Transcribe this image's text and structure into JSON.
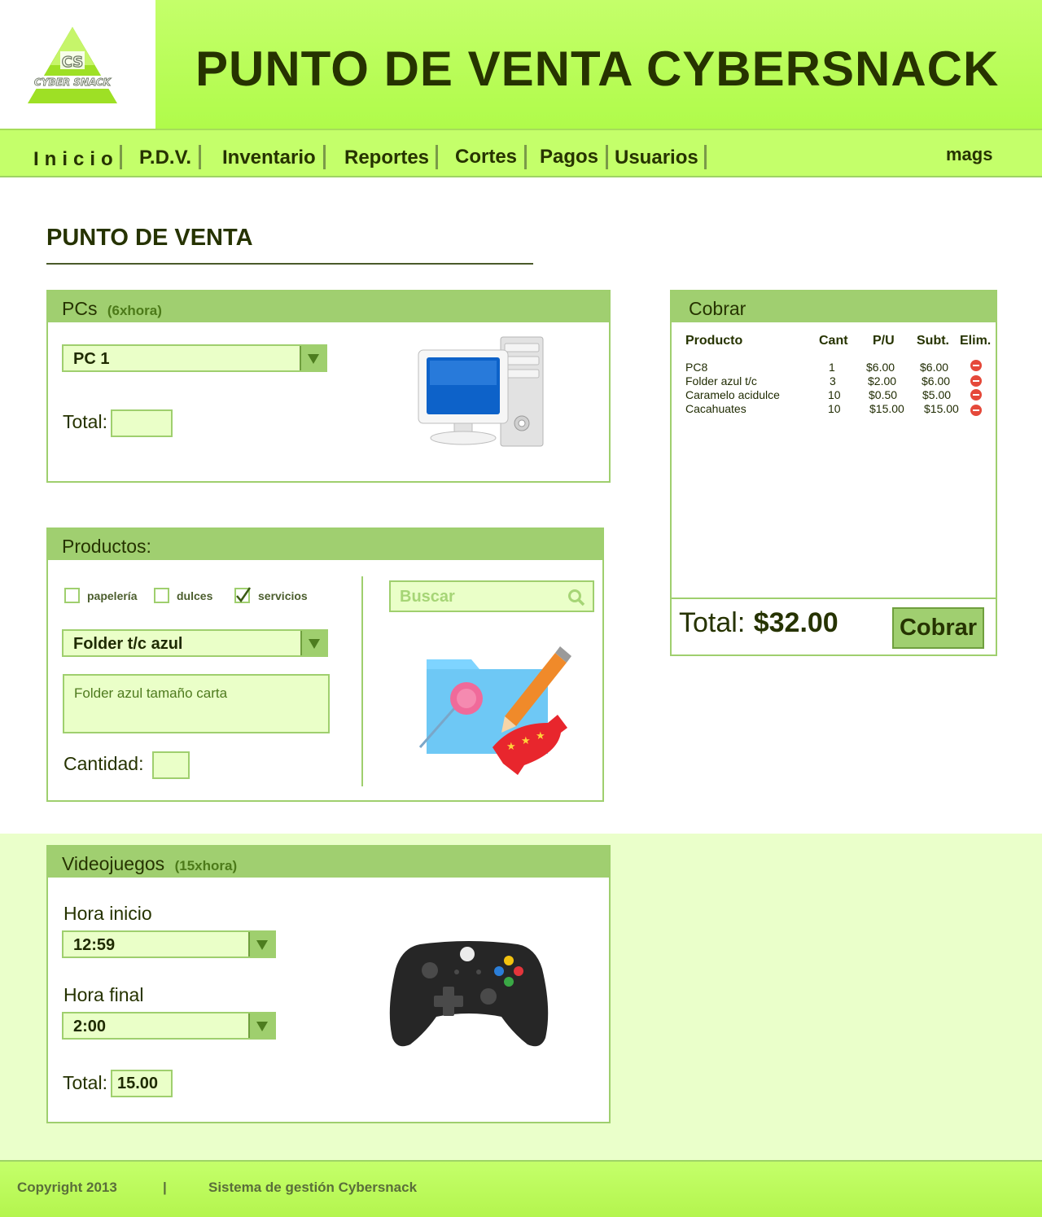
{
  "header": {
    "title": "PUNTO DE VENTA CYBERSNACK",
    "logo_text": "CYBER SNACK",
    "logo_initials": "CS"
  },
  "nav": {
    "items": [
      "Inicio",
      "P.D.V.",
      "Inventario",
      "Reportes",
      "Cortes",
      "Pagos",
      "Usuarios"
    ],
    "user": "mags"
  },
  "page": {
    "title": "PUNTO DE VENTA"
  },
  "pcs": {
    "title": "PCs",
    "rate": "(6xhora)",
    "selected_pc": "PC 1",
    "total_label": "Total:",
    "total_value": "",
    "icon": "desktop-computer-icon"
  },
  "productos": {
    "title": "Productos:",
    "filters": [
      {
        "label": "papelería",
        "checked": false
      },
      {
        "label": "dulces",
        "checked": false
      },
      {
        "label": "servicios",
        "checked": true
      }
    ],
    "selected_product": "Folder t/c azul",
    "description": "Folder azul tamaño carta",
    "quantity_label": "Cantidad:",
    "quantity_value": "",
    "search_placeholder": "Buscar",
    "icon": "folder-candy-pencil-icon"
  },
  "cobrar": {
    "title": "Cobrar",
    "columns": [
      "Producto",
      "Cant",
      "P/U",
      "Subt.",
      "Elim."
    ],
    "rows": [
      {
        "producto": "PC8",
        "cant": "1",
        "pu": "$6.00",
        "subt": "$6.00"
      },
      {
        "producto": "Folder azul t/c",
        "cant": "3",
        "pu": "$2.00",
        "subt": "$6.00"
      },
      {
        "producto": "Caramelo acidulce",
        "cant": "10",
        "pu": "$0.50",
        "subt": "$5.00"
      },
      {
        "producto": "Cacahuates",
        "cant": "10",
        "pu": "$15.00",
        "subt": "$15.00"
      }
    ],
    "total_label": "Total:",
    "total_value": "$32.00",
    "button_label": "Cobrar"
  },
  "videojuegos": {
    "title": "Videojuegos",
    "rate": "(15xhora)",
    "start_label": "Hora inicio",
    "start_value": "12:59",
    "end_label": "Hora final",
    "end_value": "2:00",
    "total_label": "Total:",
    "total_value": "15.00",
    "icon": "gamepad-icon"
  },
  "footer": {
    "copyright": "Copyright 2013",
    "separator": "|",
    "system": "Sistema de gestión Cybersnack"
  },
  "colors": {
    "accent": "#c4ff6a",
    "panel_head": "#a0cf70",
    "border": "#9fcf6e",
    "field": "#eaffc8",
    "text": "#263300"
  }
}
